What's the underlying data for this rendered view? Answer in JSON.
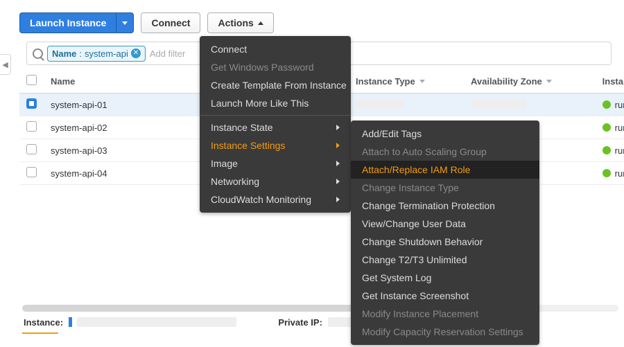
{
  "toolbar": {
    "launch_label": "Launch Instance",
    "connect_label": "Connect",
    "actions_label": "Actions"
  },
  "filter": {
    "chip_key": "Name",
    "chip_value": "system-api",
    "placeholder": "Add filter"
  },
  "columns": {
    "name": "Name",
    "instance_type": "Instance Type",
    "availability_zone": "Availability Zone",
    "instance_state": "Instance State"
  },
  "rows": [
    {
      "name": "system-api-01",
      "state": "running",
      "selected": true
    },
    {
      "name": "system-api-02",
      "state": "running",
      "selected": false
    },
    {
      "name": "system-api-03",
      "state": "running",
      "selected": false
    },
    {
      "name": "system-api-04",
      "state": "running",
      "selected": false
    }
  ],
  "actions_menu": {
    "items": [
      {
        "label": "Connect",
        "disabled": false
      },
      {
        "label": "Get Windows Password",
        "disabled": true
      },
      {
        "label": "Create Template From Instance",
        "disabled": false
      },
      {
        "label": "Launch More Like This",
        "disabled": false
      }
    ],
    "submenus": [
      {
        "label": "Instance State",
        "active": false
      },
      {
        "label": "Instance Settings",
        "active": true
      },
      {
        "label": "Image",
        "active": false
      },
      {
        "label": "Networking",
        "active": false
      },
      {
        "label": "CloudWatch Monitoring",
        "active": false
      }
    ]
  },
  "instance_settings_menu": [
    {
      "label": "Add/Edit Tags",
      "disabled": false,
      "highlight": false
    },
    {
      "label": "Attach to Auto Scaling Group",
      "disabled": true,
      "highlight": false
    },
    {
      "label": "Attach/Replace IAM Role",
      "disabled": false,
      "highlight": true
    },
    {
      "label": "Change Instance Type",
      "disabled": true,
      "highlight": false
    },
    {
      "label": "Change Termination Protection",
      "disabled": false,
      "highlight": false
    },
    {
      "label": "View/Change User Data",
      "disabled": false,
      "highlight": false
    },
    {
      "label": "Change Shutdown Behavior",
      "disabled": false,
      "highlight": false
    },
    {
      "label": "Change T2/T3 Unlimited",
      "disabled": false,
      "highlight": false
    },
    {
      "label": "Get System Log",
      "disabled": false,
      "highlight": false
    },
    {
      "label": "Get Instance Screenshot",
      "disabled": false,
      "highlight": false
    },
    {
      "label": "Modify Instance Placement",
      "disabled": true,
      "highlight": false
    },
    {
      "label": "Modify Capacity Reservation Settings",
      "disabled": true,
      "highlight": false
    }
  ],
  "details": {
    "instance_label": "Instance:",
    "private_ip_label": "Private IP:"
  },
  "colors": {
    "primary": "#2f7fe0",
    "accent": "#f39c12",
    "status_running": "#6ac221"
  }
}
